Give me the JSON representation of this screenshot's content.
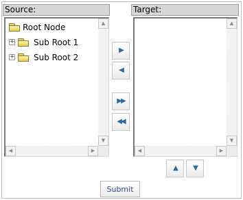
{
  "source": {
    "header": "Source:",
    "tree": [
      {
        "label": "Root Node",
        "expander": ""
      },
      {
        "label": "Sub Root 1",
        "expander": "+"
      },
      {
        "label": "Sub Root 2",
        "expander": "+"
      }
    ]
  },
  "target": {
    "header": "Target:"
  },
  "move_buttons": {
    "move_right": "▶",
    "move_left": "◀",
    "move_all_right": "▶▶",
    "move_all_left": "◀◀"
  },
  "order_buttons": {
    "up": "▲",
    "down": "▼"
  },
  "scroll_glyphs": {
    "up": "▲",
    "down": "▼",
    "left": "◀",
    "right": "▶"
  },
  "submit_label": "Submit",
  "colors": {
    "header_bg": "#d6d6d6",
    "arrow": "#2a6aa8",
    "folder": "#e6cf55",
    "submit_text": "#2b4f86"
  }
}
